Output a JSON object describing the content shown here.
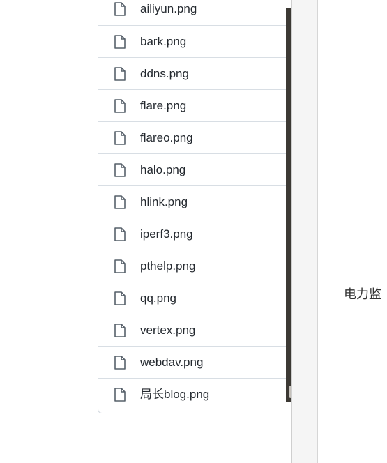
{
  "file_list": {
    "files": [
      {
        "name": "ailiyun.png",
        "icon": "file-icon"
      },
      {
        "name": "bark.png",
        "icon": "file-icon"
      },
      {
        "name": "ddns.png",
        "icon": "file-icon"
      },
      {
        "name": "flare.png",
        "icon": "file-icon"
      },
      {
        "name": "flareo.png",
        "icon": "file-icon"
      },
      {
        "name": "halo.png",
        "icon": "file-icon"
      },
      {
        "name": "hlink.png",
        "icon": "file-icon"
      },
      {
        "name": "iperf3.png",
        "icon": "file-icon"
      },
      {
        "name": "pthelp.png",
        "icon": "file-icon"
      },
      {
        "name": "qq.png",
        "icon": "file-icon"
      },
      {
        "name": "vertex.png",
        "icon": "file-icon"
      },
      {
        "name": "webdav.png",
        "icon": "file-icon"
      },
      {
        "name": "局长blog.png",
        "icon": "file-icon"
      }
    ]
  },
  "overlay_panel": {
    "text": "电力监"
  },
  "colors": {
    "border": "#d0d7de",
    "row_divider": "#d8dee4",
    "icon": "#57606a",
    "text": "#24292f",
    "scrollbar": "#3c3934"
  }
}
